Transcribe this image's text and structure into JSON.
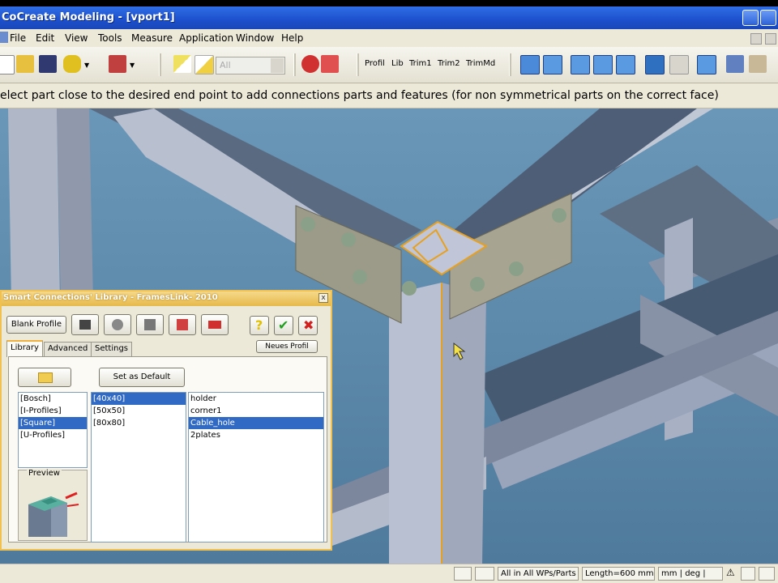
{
  "window": {
    "title": "CoCreate Modeling - [vport1]"
  },
  "menu": [
    "File",
    "Edit",
    "View",
    "Tools",
    "Measure",
    "Application",
    "Window",
    "Help"
  ],
  "toolbar": {
    "filter_value": "All",
    "labels": [
      "Profil",
      "Lib",
      "Trim1",
      "Trim2",
      "TrimMd"
    ]
  },
  "prompt": {
    "text": "elect part close to the desired end point to add connections parts and features (for non symmetrical parts on the correct face)"
  },
  "dialog": {
    "title": "Smart Connections' Library - FramesLink- 2010",
    "close_label": "x",
    "blank_profile_label": "Blank Profile",
    "neues_profil_label": "Neues Profil",
    "set_default_label": "Set as Default",
    "tabs": [
      "Library",
      "Advanced",
      "Settings"
    ],
    "active_tab": 0,
    "preview_label": "Preview",
    "list_categories": {
      "items": [
        "[Bosch]",
        "[I-Profiles]",
        "[Square]",
        "[U-Profiles]"
      ],
      "selected": 2
    },
    "list_sizes": {
      "items": [
        "[40x40]",
        "[50x50]",
        "[80x80]"
      ],
      "selected": 0
    },
    "list_parts": {
      "items": [
        "holder",
        "corner1",
        "Cable_hole",
        "2plates"
      ],
      "selected": 2
    }
  },
  "statusbar": {
    "selection": "All in All WPs/Parts",
    "length": "Length=600 mm",
    "units": "mm | deg |"
  },
  "colors": {
    "titlebar": "#1d4fcc",
    "viewport_bg": "#5a87a8",
    "dialog_border": "#f0c050",
    "selection": "#316ac5",
    "highlight": "#e8a020"
  }
}
